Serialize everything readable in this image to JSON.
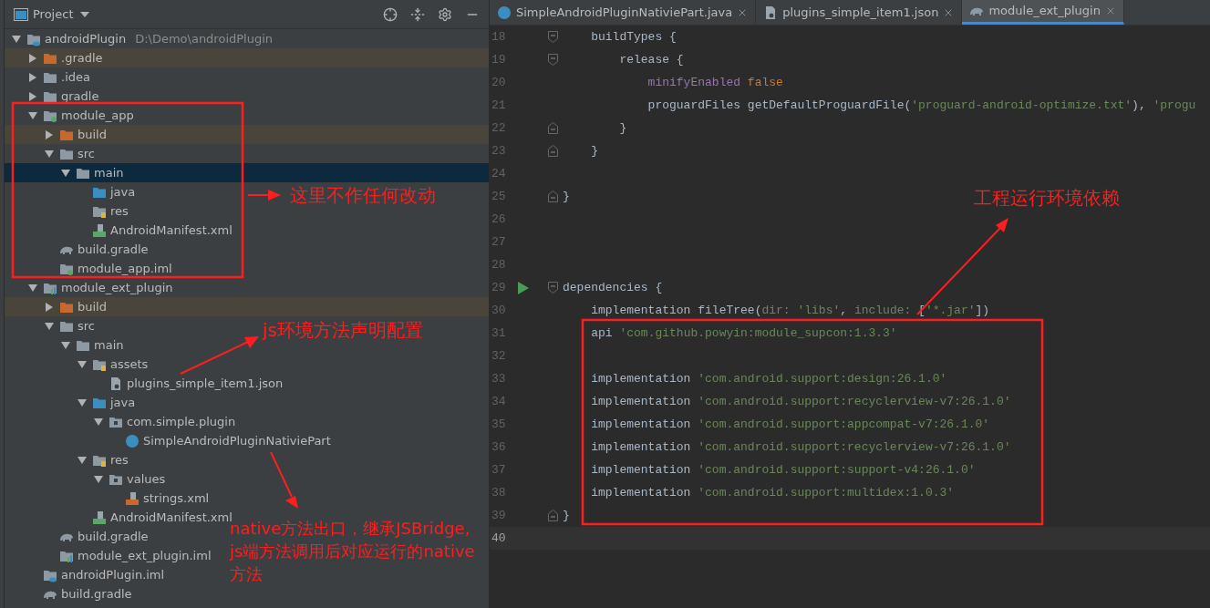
{
  "project_panel": {
    "title": "Project",
    "tree": [
      {
        "name": "androidPlugin",
        "path": "D:\\Demo\\androidPlugin",
        "kind": "project",
        "expanded": true,
        "selected": false,
        "children": [
          {
            "name": ".gradle",
            "kind": "excluded-folder",
            "expanded": false,
            "excluded": true,
            "selected": false
          },
          {
            "name": ".idea",
            "kind": "folder",
            "expanded": false,
            "selected": false
          },
          {
            "name": "gradle",
            "kind": "folder",
            "expanded": false,
            "selected": false
          },
          {
            "name": "module_app",
            "kind": "module",
            "expanded": true,
            "selected": false,
            "children": [
              {
                "name": "build",
                "kind": "excluded-folder",
                "expanded": false,
                "excluded": true,
                "selected": false
              },
              {
                "name": "src",
                "kind": "folder",
                "expanded": true,
                "selected": false,
                "children": [
                  {
                    "name": "main",
                    "kind": "folder",
                    "expanded": true,
                    "selected": true,
                    "children": [
                      {
                        "name": "java",
                        "kind": "source",
                        "selected": false
                      },
                      {
                        "name": "res",
                        "kind": "resources",
                        "selected": false
                      },
                      {
                        "name": "AndroidManifest.xml",
                        "kind": "manifest",
                        "selected": false
                      }
                    ]
                  }
                ]
              },
              {
                "name": "build.gradle",
                "kind": "gradle",
                "selected": false
              },
              {
                "name": "module_app.iml",
                "kind": "iml",
                "selected": false
              }
            ]
          },
          {
            "name": "module_ext_plugin",
            "kind": "library",
            "expanded": true,
            "selected": false,
            "children": [
              {
                "name": "build",
                "kind": "excluded-folder",
                "expanded": false,
                "excluded": true,
                "selected": false
              },
              {
                "name": "src",
                "kind": "folder",
                "expanded": true,
                "selected": false,
                "children": [
                  {
                    "name": "main",
                    "kind": "folder",
                    "expanded": true,
                    "selected": false,
                    "children": [
                      {
                        "name": "assets",
                        "kind": "resources",
                        "expanded": true,
                        "selected": false,
                        "children": [
                          {
                            "name": "plugins_simple_item1.json",
                            "kind": "json",
                            "selected": false
                          }
                        ]
                      },
                      {
                        "name": "java",
                        "kind": "source",
                        "expanded": true,
                        "selected": false,
                        "children": [
                          {
                            "name": "com.simple.plugin",
                            "kind": "package",
                            "expanded": true,
                            "selected": false,
                            "children": [
                              {
                                "name": "SimpleAndroidPluginNativiePart",
                                "kind": "class",
                                "selected": false
                              }
                            ]
                          }
                        ]
                      },
                      {
                        "name": "res",
                        "kind": "resources",
                        "expanded": true,
                        "selected": false,
                        "children": [
                          {
                            "name": "values",
                            "kind": "package",
                            "expanded": true,
                            "selected": false,
                            "children": [
                              {
                                "name": "strings.xml",
                                "kind": "xml",
                                "selected": false
                              }
                            ]
                          }
                        ]
                      },
                      {
                        "name": "AndroidManifest.xml",
                        "kind": "manifest",
                        "selected": false
                      }
                    ]
                  }
                ]
              },
              {
                "name": "build.gradle",
                "kind": "gradle",
                "selected": false
              },
              {
                "name": "module_ext_plugin.iml",
                "kind": "library-iml",
                "selected": false
              }
            ]
          },
          {
            "name": "androidPlugin.iml",
            "kind": "project",
            "selected": false
          },
          {
            "name": "build.gradle",
            "kind": "gradle",
            "selected": false
          }
        ]
      }
    ]
  },
  "editor": {
    "tabs": [
      {
        "label": "SimpleAndroidPluginNativiePart.java",
        "kind": "class",
        "selected": false
      },
      {
        "label": "plugins_simple_item1.json",
        "kind": "json",
        "selected": false
      },
      {
        "label": "module_ext_plugin",
        "kind": "gradle",
        "selected": true
      }
    ],
    "lines": [
      {
        "number": "18",
        "fold_start": true,
        "tokens": [
          {
            "kind": "plain",
            "text": "    buildTypes {"
          }
        ]
      },
      {
        "number": "19",
        "fold_start": true,
        "tokens": [
          {
            "kind": "plain",
            "text": "        release {"
          }
        ]
      },
      {
        "number": "20",
        "tokens": [
          {
            "kind": "field",
            "text": "            minifyEnabled"
          },
          {
            "kind": "keyword",
            "text": " false"
          }
        ]
      },
      {
        "number": "21",
        "tokens": [
          {
            "kind": "plain",
            "text": "            proguardFiles getDefaultProguardFile("
          },
          {
            "kind": "string",
            "text": "'proguard-android-optimize.txt'"
          },
          {
            "kind": "plain",
            "text": "), "
          },
          {
            "kind": "string",
            "text": "'progu"
          }
        ]
      },
      {
        "number": "22",
        "fold_end": true,
        "tokens": [
          {
            "kind": "plain",
            "text": "        }"
          }
        ]
      },
      {
        "number": "23",
        "fold_end": true,
        "tokens": [
          {
            "kind": "plain",
            "text": "    }"
          }
        ]
      },
      {
        "number": "24"
      },
      {
        "number": "25",
        "fold_end": true,
        "tokens": [
          {
            "kind": "plain",
            "text": "}"
          }
        ]
      },
      {
        "number": "26"
      },
      {
        "number": "27"
      },
      {
        "number": "28"
      },
      {
        "number": "29",
        "fold_start": true,
        "run": true,
        "tokens": [
          {
            "kind": "plain",
            "text": "dependencies {"
          }
        ]
      },
      {
        "number": "30",
        "tokens": [
          {
            "kind": "plain",
            "text": "    implementation fileTree("
          },
          {
            "kind": "param",
            "text": "dir: "
          },
          {
            "kind": "string",
            "text": "'libs'"
          },
          {
            "kind": "plain",
            "text": ", "
          },
          {
            "kind": "param",
            "text": "include: "
          },
          {
            "kind": "plain",
            "text": "["
          },
          {
            "kind": "string",
            "text": "'*.jar'"
          },
          {
            "kind": "plain",
            "text": "])"
          }
        ]
      },
      {
        "number": "31",
        "tokens": [
          {
            "kind": "plain",
            "text": "    api "
          },
          {
            "kind": "string",
            "text": "'com.github.powyin:module_supcon:1.3.3'"
          }
        ]
      },
      {
        "number": "32"
      },
      {
        "number": "33",
        "tokens": [
          {
            "kind": "plain",
            "text": "    implementation "
          },
          {
            "kind": "string",
            "text": "'com.android.support:design:26.1.0'"
          }
        ]
      },
      {
        "number": "34",
        "tokens": [
          {
            "kind": "plain",
            "text": "    implementation "
          },
          {
            "kind": "string",
            "text": "'com.android.support:recyclerview-v7:26.1.0'"
          }
        ]
      },
      {
        "number": "35",
        "tokens": [
          {
            "kind": "plain",
            "text": "    implementation "
          },
          {
            "kind": "string",
            "text": "'com.android.support:appcompat-v7:26.1.0'"
          }
        ]
      },
      {
        "number": "36",
        "tokens": [
          {
            "kind": "plain",
            "text": "    implementation "
          },
          {
            "kind": "string",
            "text": "'com.android.support:recyclerview-v7:26.1.0'"
          }
        ]
      },
      {
        "number": "37",
        "tokens": [
          {
            "kind": "plain",
            "text": "    implementation "
          },
          {
            "kind": "string",
            "text": "'com.android.support:support-v4:26.1.0'"
          }
        ]
      },
      {
        "number": "38",
        "tokens": [
          {
            "kind": "plain",
            "text": "    implementation "
          },
          {
            "kind": "string",
            "text": "'com.android.support:multidex:1.0.3'"
          }
        ]
      },
      {
        "number": "39",
        "fold_end": true,
        "tokens": [
          {
            "kind": "plain",
            "text": "}"
          }
        ]
      },
      {
        "number": "40",
        "current": true
      }
    ]
  },
  "annotations": [
    {
      "kind": "callout",
      "lines": [
        "这里不作任何改动"
      ]
    },
    {
      "kind": "callout",
      "lines": [
        "js环境方法声明配置"
      ]
    },
    {
      "kind": "callout",
      "lines": [
        "native方法出口，继承JSBridge,",
        "js端方法调用后对应运行的native",
        "方法"
      ]
    },
    {
      "kind": "callout",
      "lines": [
        "工程运行环境依赖"
      ]
    }
  ]
}
